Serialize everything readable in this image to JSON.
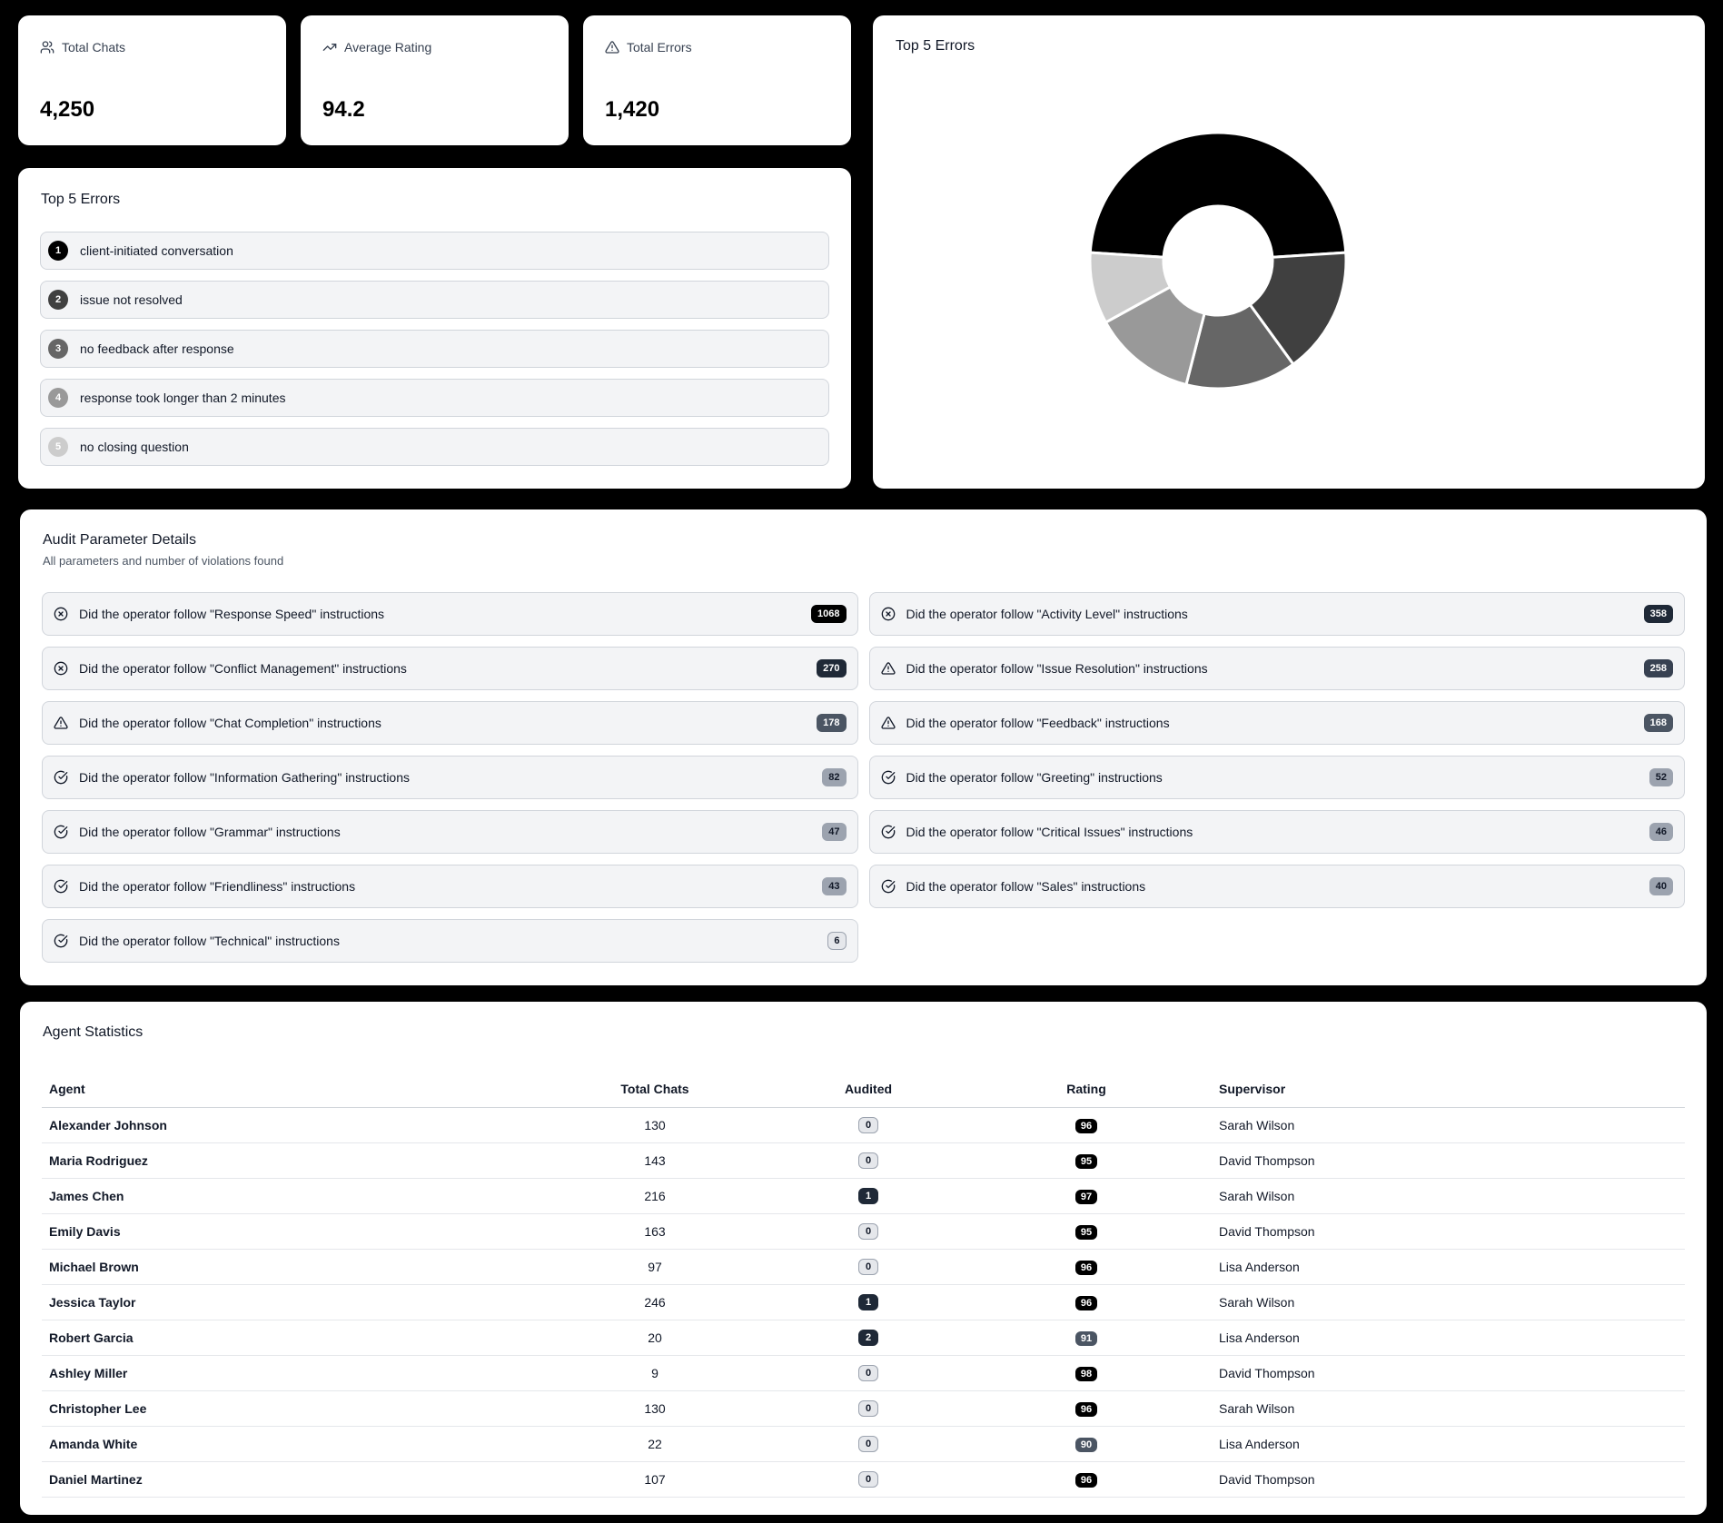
{
  "stats": [
    {
      "label": "Total Chats",
      "value": "4,250",
      "icon": "users-icon"
    },
    {
      "label": "Average Rating",
      "value": "94.2",
      "icon": "trending-up-icon"
    },
    {
      "label": "Total Errors",
      "value": "1,420",
      "icon": "alert-triangle-icon"
    }
  ],
  "top_errors": {
    "title": "Top 5 Errors",
    "items": [
      {
        "num": "1",
        "label": "client-initiated conversation",
        "color": "#000000"
      },
      {
        "num": "2",
        "label": "issue not resolved",
        "color": "#404040"
      },
      {
        "num": "3",
        "label": "no feedback after response",
        "color": "#666666"
      },
      {
        "num": "4",
        "label": "response took longer than 2 minutes",
        "color": "#999999"
      },
      {
        "num": "5",
        "label": "no closing question",
        "color": "#cccccc"
      }
    ]
  },
  "chart_panel": {
    "title": "Top 5 Errors"
  },
  "chart_data": {
    "type": "pie",
    "donut": true,
    "categories": [
      "client-initiated conversation",
      "issue not resolved",
      "no feedback after response",
      "response took longer than 2 minutes",
      "no closing question"
    ],
    "values": [
      48,
      16,
      14,
      13,
      9
    ],
    "colors": [
      "#000000",
      "#404040",
      "#666666",
      "#999999",
      "#cccccc"
    ],
    "legend": "none"
  },
  "audit": {
    "title": "Audit Parameter Details",
    "subtitle": "All parameters and number of violations found",
    "items": [
      {
        "label": "Did the operator follow \"Response Speed\" instructions",
        "count": "1068",
        "icon": "x-circle-icon",
        "badge_bg": "#000000",
        "badge_fg": "#ffffff"
      },
      {
        "label": "Did the operator follow \"Activity Level\" instructions",
        "count": "358",
        "icon": "x-circle-icon",
        "badge_bg": "#1f2937",
        "badge_fg": "#ffffff"
      },
      {
        "label": "Did the operator follow \"Conflict Management\" instructions",
        "count": "270",
        "icon": "x-circle-icon",
        "badge_bg": "#1f2937",
        "badge_fg": "#ffffff"
      },
      {
        "label": "Did the operator follow \"Issue Resolution\" instructions",
        "count": "258",
        "icon": "alert-triangle-icon",
        "badge_bg": "#374151",
        "badge_fg": "#ffffff"
      },
      {
        "label": "Did the operator follow \"Chat Completion\" instructions",
        "count": "178",
        "icon": "alert-triangle-icon",
        "badge_bg": "#4b5563",
        "badge_fg": "#ffffff"
      },
      {
        "label": "Did the operator follow \"Feedback\" instructions",
        "count": "168",
        "icon": "alert-triangle-icon",
        "badge_bg": "#4b5563",
        "badge_fg": "#ffffff"
      },
      {
        "label": "Did the operator follow \"Information Gathering\" instructions",
        "count": "82",
        "icon": "check-circle-icon",
        "badge_bg": "#9ca3af",
        "badge_fg": "#111827"
      },
      {
        "label": "Did the operator follow \"Greeting\" instructions",
        "count": "52",
        "icon": "check-circle-icon",
        "badge_bg": "#9ca3af",
        "badge_fg": "#111827"
      },
      {
        "label": "Did the operator follow \"Grammar\" instructions",
        "count": "47",
        "icon": "check-circle-icon",
        "badge_bg": "#9ca3af",
        "badge_fg": "#111827"
      },
      {
        "label": "Did the operator follow \"Critical Issues\" instructions",
        "count": "46",
        "icon": "check-circle-icon",
        "badge_bg": "#9ca3af",
        "badge_fg": "#111827"
      },
      {
        "label": "Did the operator follow \"Friendliness\" instructions",
        "count": "43",
        "icon": "check-circle-icon",
        "badge_bg": "#9ca3af",
        "badge_fg": "#111827"
      },
      {
        "label": "Did the operator follow \"Sales\" instructions",
        "count": "40",
        "icon": "check-circle-icon",
        "badge_bg": "#9ca3af",
        "badge_fg": "#111827"
      },
      {
        "label": "Did the operator follow \"Technical\" instructions",
        "count": "6",
        "icon": "check-circle-icon",
        "badge_bg": "#e5e7eb",
        "badge_fg": "#111827"
      }
    ]
  },
  "agents": {
    "title": "Agent Statistics",
    "columns": [
      "Agent",
      "Total Chats",
      "Audited",
      "Rating",
      "Supervisor"
    ],
    "rows": [
      {
        "agent": "Alexander Johnson",
        "total": "130",
        "audited": "0",
        "rating": "96",
        "supervisor": "Sarah Wilson"
      },
      {
        "agent": "Maria Rodriguez",
        "total": "143",
        "audited": "0",
        "rating": "95",
        "supervisor": "David Thompson"
      },
      {
        "agent": "James Chen",
        "total": "216",
        "audited": "1",
        "rating": "97",
        "supervisor": "Sarah Wilson"
      },
      {
        "agent": "Emily Davis",
        "total": "163",
        "audited": "0",
        "rating": "95",
        "supervisor": "David Thompson"
      },
      {
        "agent": "Michael Brown",
        "total": "97",
        "audited": "0",
        "rating": "96",
        "supervisor": "Lisa Anderson"
      },
      {
        "agent": "Jessica Taylor",
        "total": "246",
        "audited": "1",
        "rating": "96",
        "supervisor": "Sarah Wilson"
      },
      {
        "agent": "Robert Garcia",
        "total": "20",
        "audited": "2",
        "rating": "91",
        "supervisor": "Lisa Anderson"
      },
      {
        "agent": "Ashley Miller",
        "total": "9",
        "audited": "0",
        "rating": "98",
        "supervisor": "David Thompson"
      },
      {
        "agent": "Christopher Lee",
        "total": "130",
        "audited": "0",
        "rating": "96",
        "supervisor": "Sarah Wilson"
      },
      {
        "agent": "Amanda White",
        "total": "22",
        "audited": "0",
        "rating": "90",
        "supervisor": "Lisa Anderson"
      },
      {
        "agent": "Daniel Martinez",
        "total": "107",
        "audited": "0",
        "rating": "96",
        "supervisor": "David Thompson"
      }
    ]
  }
}
